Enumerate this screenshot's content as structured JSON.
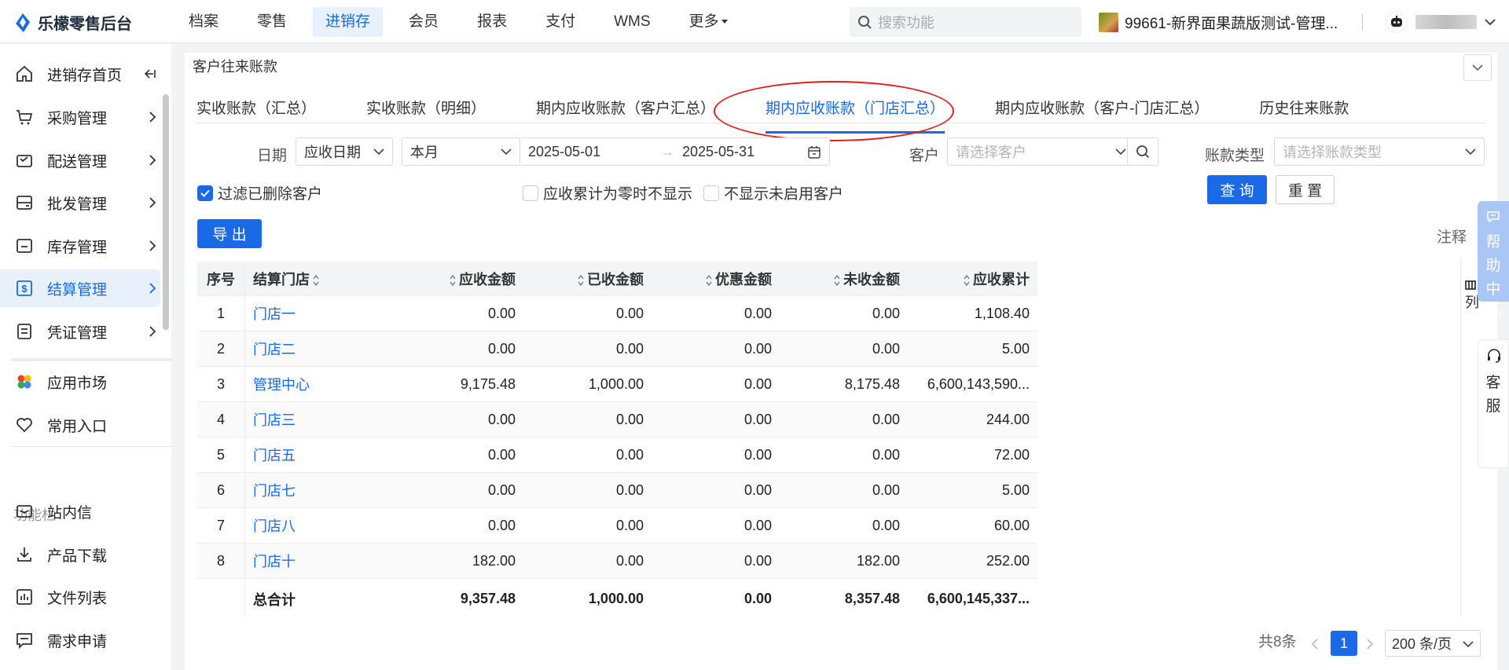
{
  "app": {
    "title": "乐檬零售后台"
  },
  "nav": [
    "档案",
    "零售",
    "进销存",
    "会员",
    "报表",
    "支付",
    "WMS",
    "更多"
  ],
  "search": {
    "placeholder": "搜索功能"
  },
  "store": {
    "name": "99661-新界面果蔬版测试-管理..."
  },
  "sidebar": {
    "items": [
      {
        "label": "进销存首页"
      },
      {
        "label": "采购管理"
      },
      {
        "label": "配送管理"
      },
      {
        "label": "批发管理"
      },
      {
        "label": "库存管理"
      },
      {
        "label": "结算管理"
      },
      {
        "label": "凭证管理"
      }
    ],
    "extra": [
      {
        "label": "应用市场"
      },
      {
        "label": "常用入口"
      }
    ],
    "group_label": "功能栏",
    "tools": [
      {
        "label": "站内信"
      },
      {
        "label": "产品下载"
      },
      {
        "label": "文件列表"
      },
      {
        "label": "需求申请"
      }
    ]
  },
  "page_tab": "客户往来账款",
  "subtabs": [
    "实收账款（汇总）",
    "实收账款（明细）",
    "期内应收账款（客户汇总）",
    "期内应收账款（门店汇总）",
    "期内应收账款（客户-门店汇总）",
    "历史往来账款"
  ],
  "filters": {
    "date_label": "日期",
    "date_type": "应收日期",
    "period": "本月",
    "start_date": "2025-05-01",
    "end_date": "2025-05-31",
    "customer_label": "客户",
    "customer_placeholder": "请选择客户",
    "account_type_label": "账款类型",
    "account_type_placeholder": "请选择账款类型",
    "cb_filter_deleted": "过滤已删除客户",
    "cb_hide_zero": "应收累计为零时不显示",
    "cb_hide_inactive": "不显示未启用客户",
    "query_btn": "查 询",
    "reset_btn": "重 置",
    "export_btn": "导 出",
    "note": "注释"
  },
  "table": {
    "headers": [
      "序号",
      "结算门店",
      "应收金额",
      "已收金额",
      "优惠金额",
      "未收金额",
      "应收累计"
    ],
    "rows": [
      [
        "1",
        "门店一",
        "0.00",
        "0.00",
        "0.00",
        "0.00",
        "1,108.40"
      ],
      [
        "2",
        "门店二",
        "0.00",
        "0.00",
        "0.00",
        "0.00",
        "5.00"
      ],
      [
        "3",
        "管理中心",
        "9,175.48",
        "1,000.00",
        "0.00",
        "8,175.48",
        "6,600,143,590..."
      ],
      [
        "4",
        "门店三",
        "0.00",
        "0.00",
        "0.00",
        "0.00",
        "244.00"
      ],
      [
        "5",
        "门店五",
        "0.00",
        "0.00",
        "0.00",
        "0.00",
        "72.00"
      ],
      [
        "6",
        "门店七",
        "0.00",
        "0.00",
        "0.00",
        "0.00",
        "5.00"
      ],
      [
        "7",
        "门店八",
        "0.00",
        "0.00",
        "0.00",
        "0.00",
        "60.00"
      ],
      [
        "8",
        "门店十",
        "182.00",
        "0.00",
        "0.00",
        "182.00",
        "252.00"
      ]
    ],
    "total": [
      "",
      "总合计",
      "9,357.48",
      "1,000.00",
      "0.00",
      "8,357.48",
      "6,600,145,337..."
    ],
    "col_settings": "列"
  },
  "help": {
    "label": "帮助中心"
  },
  "service": {
    "label": "客服"
  },
  "pager": {
    "total": "共8条",
    "page": "1",
    "page_size": "200 条/页"
  },
  "colors": {
    "accent": "#1a6ae8",
    "highlight_ring": "#e02020"
  }
}
